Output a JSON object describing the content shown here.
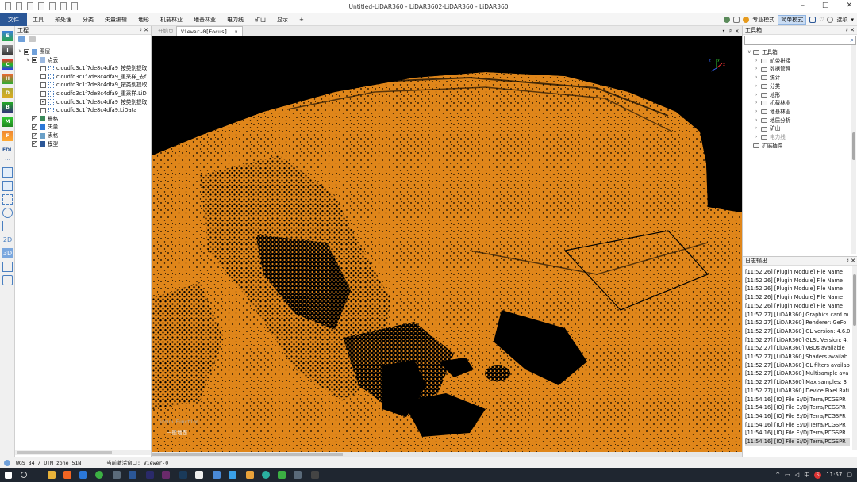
{
  "window": {
    "title": "Untitled-LiDAR360 - LiDAR3602-LiDAR360 - LiDAR360",
    "controls": [
      "–",
      "□",
      "✕"
    ]
  },
  "menu": {
    "items": [
      "文件",
      "工具",
      "预处理",
      "分类",
      "矢量编辑",
      "地形",
      "机载林业",
      "地基林业",
      "电力线",
      "矿山",
      "显示",
      "+"
    ],
    "active": "文件",
    "right": {
      "pro_mode": "专业模式",
      "simple_mode": "简单模式",
      "options": "选项"
    }
  },
  "left_toolbar": [
    "E",
    "I",
    "C",
    "H",
    "D",
    "B",
    "M",
    "F",
    "EDL",
    "···",
    "",
    "",
    "",
    "",
    "",
    "2D",
    "3D",
    "",
    ""
  ],
  "project_panel": {
    "title": "工程",
    "controls": "♯ ✕",
    "tree": [
      {
        "label": "图层",
        "level": 0,
        "check": "partial",
        "twisty": "∨"
      },
      {
        "label": "点云",
        "level": 1,
        "check": "partial",
        "twisty": "∨"
      },
      {
        "label": "cloudfd3c1f7de8c4dfa9_按类别提取",
        "level": 2,
        "check": "none"
      },
      {
        "label": "cloudfd3c1f7de8c4dfa9_重采样_去f",
        "level": 2,
        "check": "none"
      },
      {
        "label": "cloudfd3c1f7de8c4dfa9_按类别提取",
        "level": 2,
        "check": "none"
      },
      {
        "label": "cloudfd3c1f7de8c4dfa9_重采样.LiD",
        "level": 2,
        "check": "none"
      },
      {
        "label": "cloudfd3c1f7de8c4dfa9_按类别提取",
        "level": 2,
        "check": "checked"
      },
      {
        "label": "cloudfd3c1f7de8c4dfa9.LiData",
        "level": 2,
        "check": "none"
      },
      {
        "label": "栅格",
        "level": 1,
        "check": "checked"
      },
      {
        "label": "矢量",
        "level": 1,
        "check": "checked"
      },
      {
        "label": "表格",
        "level": 1,
        "check": "checked"
      },
      {
        "label": "模型",
        "level": 1,
        "check": "checked"
      }
    ]
  },
  "viewer": {
    "tabs": [
      {
        "label": "开始页",
        "active": false
      },
      {
        "label": "Viewer-0[Focus]",
        "active": true,
        "close": "✕"
      }
    ],
    "controls": "▾ ♯ ✕",
    "legend": {
      "title": "Group Function",
      "item": "一般地面",
      "color": "#e0861a"
    },
    "axis_labels": [
      "y",
      "z",
      "x"
    ],
    "point_color": "#e0861a",
    "background": "#000000"
  },
  "toolbox": {
    "title": "工具箱",
    "controls": "♯ ✕",
    "search_placeholder": "",
    "items": [
      {
        "label": "工具箱",
        "level": 0,
        "twisty": "∨"
      },
      {
        "label": "航带拼接",
        "level": 1,
        "twisty": "›"
      },
      {
        "label": "数据管理",
        "level": 1,
        "twisty": "›"
      },
      {
        "label": "统计",
        "level": 1,
        "twisty": "›"
      },
      {
        "label": "分类",
        "level": 1,
        "twisty": "›"
      },
      {
        "label": "地形",
        "level": 1,
        "twisty": "›"
      },
      {
        "label": "机载林业",
        "level": 1,
        "twisty": "›"
      },
      {
        "label": "地基林业",
        "level": 1,
        "twisty": "›"
      },
      {
        "label": "地质分析",
        "level": 1,
        "twisty": "›"
      },
      {
        "label": "矿山",
        "level": 1,
        "twisty": "›"
      },
      {
        "label": "电力线",
        "level": 1,
        "twisty": "›",
        "disabled": true
      },
      {
        "label": "扩展插件",
        "level": 0,
        "twisty": ""
      }
    ]
  },
  "log_panel": {
    "title": "日志输出",
    "controls": "♯ ✕",
    "lines": [
      "[11:52:26] [Plugin Module]    File Name",
      "[11:52:26] [Plugin Module]    File Name",
      "[11:52:26] [Plugin Module]    File Name",
      "[11:52:26] [Plugin Module]    File Name",
      "[11:52:26] [Plugin Module]    File Name",
      "[11:52:27] [LiDAR360]    Graphics card m",
      "[11:52:27] [LiDAR360]    Renderer: GeFo",
      "[11:52:27] [LiDAR360]    GL version: 4.6.0",
      "[11:52:27] [LiDAR360]    GLSL Version: 4.",
      "[11:52:27] [LiDAR360]    VBOs available",
      "[11:52:27] [LiDAR360]    Shaders availab",
      "[11:52:27] [LiDAR360]    GL filters availab",
      "[11:52:27] [LiDAR360]    Multisample ava",
      "[11:52:27] [LiDAR360]    Max samples: 3",
      "[11:52:27] [LiDAR360]    Device Pixel Rati",
      "[11:54:16] [IO]    File E:/DjiTerra/PCGSPR",
      "[11:54:16] [IO]    File E:/DjiTerra/PCGSPR",
      "[11:54:16] [IO]    File E:/DjiTerra/PCGSPR",
      "[11:54:16] [IO]    File E:/DjiTerra/PCGSPR",
      "[11:54:16] [IO]    File E:/DjiTerra/PCGSPR",
      "[11:54:16] [IO]    File E:/DjiTerra/PCGSPR"
    ],
    "selected_index": 20
  },
  "status_bar": {
    "crs": "WGS 84 / UTM zone 51N",
    "current_window": "当前激活窗口: Viewer-0"
  },
  "taskbar": {
    "tray_text": "中",
    "ime": "S",
    "time": "11:57"
  }
}
